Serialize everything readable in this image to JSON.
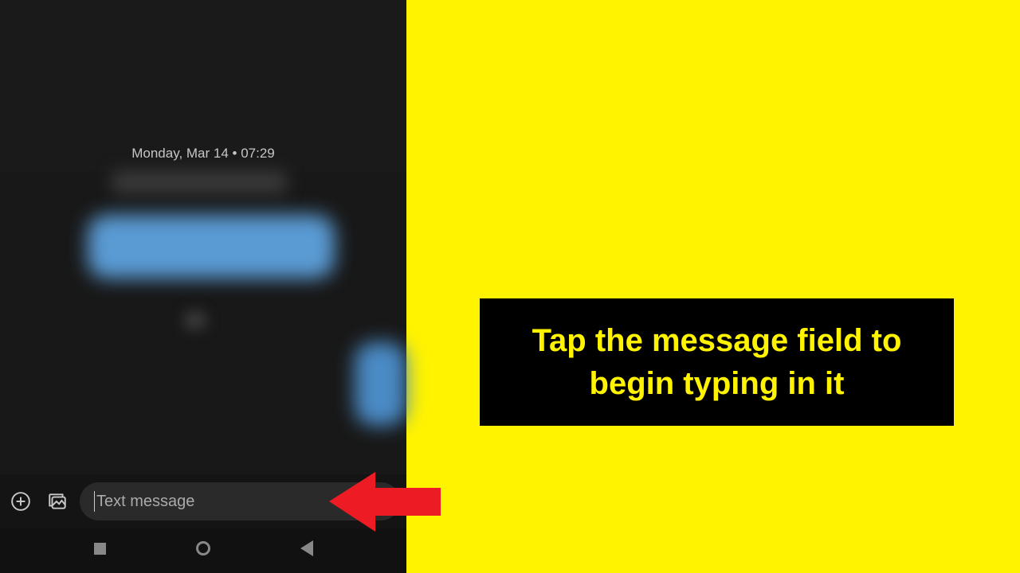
{
  "chat": {
    "timestamp": "Monday, Mar 14 • 07:29",
    "input_placeholder": "Text message"
  },
  "callout": {
    "text": "Tap the message field to begin typing in it"
  }
}
